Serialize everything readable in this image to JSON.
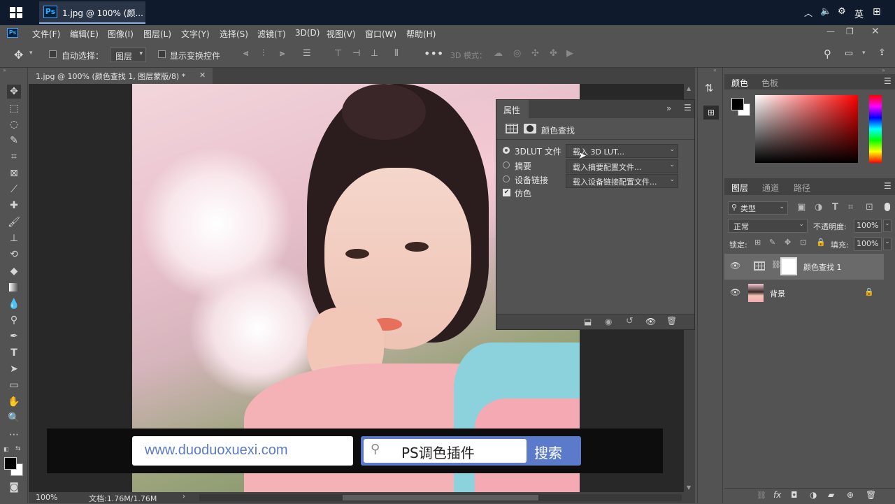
{
  "taskbar": {
    "ps_icon": "Ps",
    "title": "1.jpg @ 100% (颜...",
    "ime": "英",
    "tray_icons": [
      "chevron-up-icon",
      "volume-icon",
      "ime-settings-icon",
      "keyboard-icon"
    ]
  },
  "menu": {
    "items": [
      "文件(F)",
      "编辑(E)",
      "图像(I)",
      "图层(L)",
      "文字(Y)",
      "选择(S)",
      "滤镜(T)",
      "3D(D)",
      "视图(V)",
      "窗口(W)",
      "帮助(H)"
    ]
  },
  "options": {
    "auto_select_label": "自动选择：",
    "auto_select_value": "图层",
    "show_transform_label": "显示变换控件",
    "mode_3d_label": "3D 模式："
  },
  "document": {
    "tab_title": "1.jpg @ 100% (颜色查找 1, 图层蒙版/8) *",
    "zoom": "100%",
    "doc_info": "文档:1.76M/1.76M"
  },
  "properties": {
    "title": "属性",
    "header": "颜色查找",
    "rows": [
      {
        "label": "3DLUT 文件",
        "value": "载入 3D LUT..."
      },
      {
        "label": "摘要",
        "value": "载入摘要配置文件..."
      },
      {
        "label": "设备链接",
        "value": "载入设备链接配置文件..."
      }
    ],
    "dither_label": "仿色"
  },
  "color_panel": {
    "tabs": [
      "颜色",
      "色板"
    ]
  },
  "layers_panel": {
    "tabs": [
      "图层",
      "通道",
      "路径"
    ],
    "filter_label": "类型",
    "blend_mode": "正常",
    "opacity_label": "不透明度:",
    "opacity_value": "100%",
    "lock_label": "锁定:",
    "fill_label": "填充:",
    "fill_value": "100%",
    "layers": [
      {
        "name": "颜色查找 1"
      },
      {
        "name": "背景"
      }
    ]
  },
  "overlay": {
    "url": "www.duoduoxuexi.com",
    "search_text": "PS调色插件",
    "search_button": "搜索"
  },
  "colors": {
    "accent_blue": "#5b7ac9",
    "ps_blue": "#31a8ff"
  }
}
